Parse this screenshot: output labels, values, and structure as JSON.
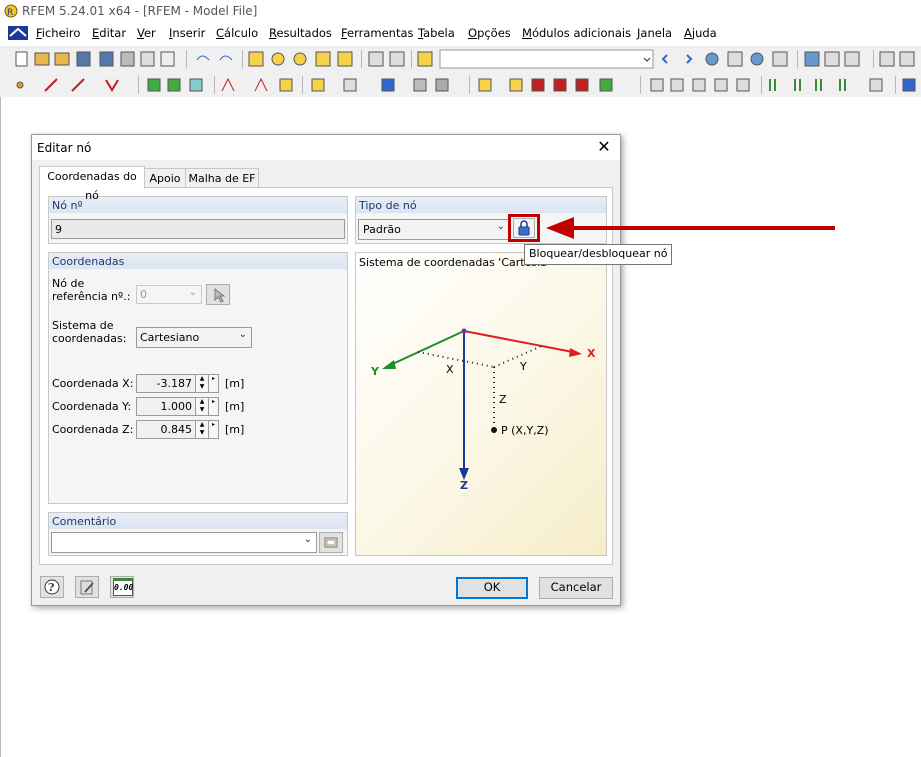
{
  "app": {
    "title": "RFEM 5.24.01 x64 - [RFEM - Model File]"
  },
  "menu": [
    "Ficheiro",
    "Editar",
    "Ver",
    "Inserir",
    "Cálculo",
    "Resultados",
    "Ferramentas",
    "Tabela",
    "Opções",
    "Módulos adicionais",
    "Janela",
    "Ajuda"
  ],
  "dialog": {
    "title": "Editar nó",
    "tabs": [
      "Coordenadas do nó",
      "Apoio",
      "Malha de EF"
    ],
    "node_no_label": "Nó nº",
    "node_no_value": "9",
    "node_type_label": "Tipo de nó",
    "node_type_value": "Padrão",
    "coords_group_label": "Coordenadas",
    "ref_node_label_1": "Nó de",
    "ref_node_label_2": "referência nº.:",
    "ref_node_value": "0",
    "coord_sys_label_1": "Sistema de",
    "coord_sys_label_2": "coordenadas:",
    "coord_sys_value": "Cartesiano",
    "coord_x_label": "Coordenada X:",
    "coord_x_value": "-3.187",
    "coord_y_label": "Coordenada Y:",
    "coord_y_value": "1.000",
    "coord_z_label": "Coordenada Z:",
    "coord_z_value": "0.845",
    "unit": "[m]",
    "preview_label": "Sistema de coordenadas 'Cartesia",
    "axis_x": "X",
    "axis_y": "Y",
    "axis_z": "Z",
    "dim_x": "X",
    "dim_y": "Y",
    "dim_z": "Z",
    "point_label": "P (X,Y,Z)",
    "comment_label": "Comentário",
    "comment_value": "",
    "units_icon_label": "0.00",
    "ok_label": "OK",
    "cancel_label": "Cancelar"
  },
  "tooltip": "Bloquear/desbloquear nó",
  "colors": {
    "highlight_red": "#c00000",
    "axis_red": "#e02020",
    "axis_green": "#1a8f2a",
    "axis_blue": "#1a3a9a",
    "group_header": "#dbe4f0",
    "preview_bg": "#fbf6e3"
  },
  "icons": [
    "rfem-app-icon",
    "close-icon",
    "lock-icon",
    "pick-node-icon",
    "comment-library-icon",
    "help-icon",
    "edit-icon",
    "units-icon"
  ]
}
